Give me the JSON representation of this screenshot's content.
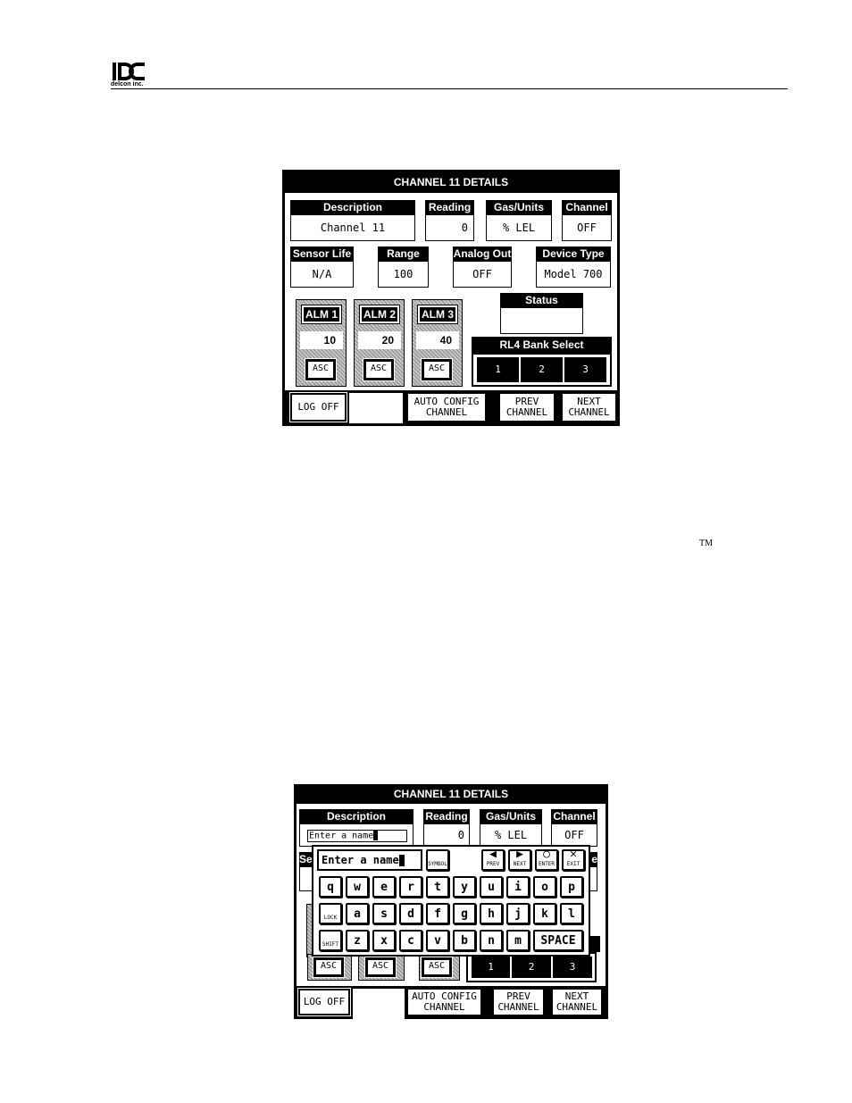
{
  "company": {
    "logo_text": "delcon inc."
  },
  "trademark": "TM",
  "screen1": {
    "title": "CHANNEL 11  DETAILS",
    "description": {
      "label": "Description",
      "value": "Channel 11"
    },
    "reading": {
      "label": "Reading",
      "value": "0"
    },
    "gas_units": {
      "label": "Gas/Units",
      "value": "%  LEL"
    },
    "channel": {
      "label": "Channel",
      "value": "OFF"
    },
    "sensor_life": {
      "label": "Sensor Life",
      "value": "N/A"
    },
    "range": {
      "label": "Range",
      "value": "100"
    },
    "analog_out": {
      "label": "Analog Out",
      "value": "OFF"
    },
    "device_type": {
      "label": "Device Type",
      "value": "Model 700"
    },
    "status": {
      "label": "Status",
      "value": ""
    },
    "alarms": [
      {
        "label": "ALM 1",
        "value": "10",
        "asc": "ASC"
      },
      {
        "label": "ALM 2",
        "value": "20",
        "asc": "ASC"
      },
      {
        "label": "ALM 3",
        "value": "40",
        "asc": "ASC"
      }
    ],
    "bank_select": {
      "label": "RL4 Bank Select",
      "buttons": [
        "1",
        "2",
        "3"
      ]
    },
    "buttons": {
      "log_off": "LOG OFF",
      "auto_config_1": "AUTO CONFIG",
      "auto_config_2": "CHANNEL",
      "prev_1": "PREV",
      "prev_2": "CHANNEL",
      "next_1": "NEXT",
      "next_2": "CHANNEL"
    }
  },
  "screen2": {
    "title": "CHANNEL 11  DETAILS",
    "description": {
      "label": "Description",
      "value": "Enter a name"
    },
    "reading": {
      "label": "Reading",
      "value": "0"
    },
    "gas_units": {
      "label": "Gas/Units",
      "value": "%  LEL"
    },
    "channel": {
      "label": "Channel",
      "value": "OFF"
    },
    "partial_left": "Se",
    "partial_right": "e",
    "asc": [
      "ASC",
      "ASC",
      "ASC"
    ],
    "bank_buttons": [
      "1",
      "2",
      "3"
    ],
    "keyboard": {
      "entry": "Enter a name",
      "symbol": "SYMBOL",
      "prev": "PREV",
      "next": "NEXT",
      "enter": "ENTER",
      "exit": "EXIT",
      "row1": [
        "q",
        "w",
        "e",
        "r",
        "t",
        "y",
        "u",
        "i",
        "o",
        "p"
      ],
      "lock": "LOCK",
      "row2": [
        "a",
        "s",
        "d",
        "f",
        "g",
        "h",
        "j",
        "k",
        "l"
      ],
      "shift": "SHIFT",
      "row3": [
        "z",
        "x",
        "c",
        "v",
        "b",
        "n",
        "m"
      ],
      "space": "SPACE"
    },
    "buttons": {
      "log_off": "LOG OFF",
      "auto_config_1": "AUTO CONFIG",
      "auto_config_2": "CHANNEL",
      "prev_1": "PREV",
      "prev_2": "CHANNEL",
      "next_1": "NEXT",
      "next_2": "CHANNEL"
    }
  }
}
